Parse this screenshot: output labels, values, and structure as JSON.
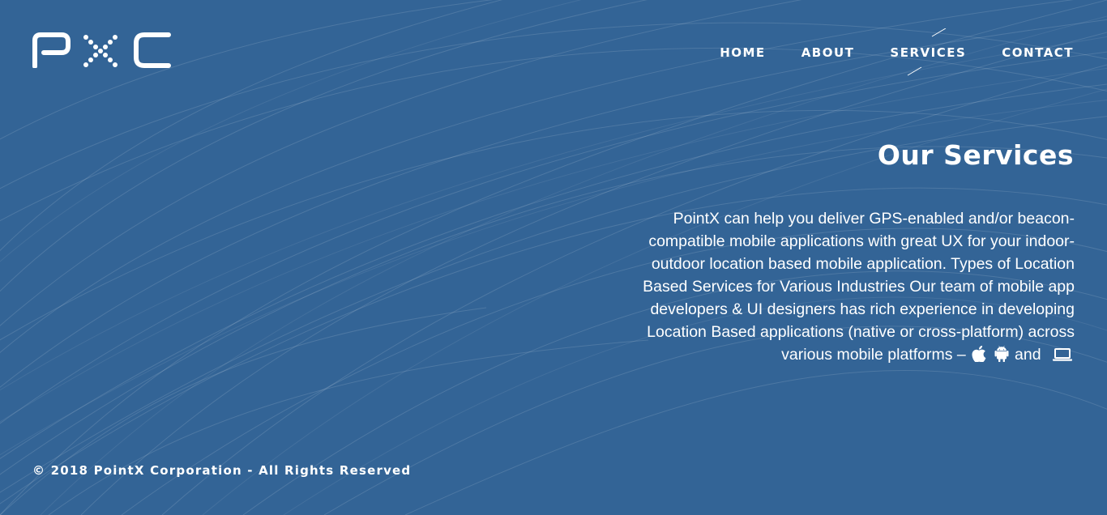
{
  "brand": {
    "logo_text": "PXC"
  },
  "nav": {
    "items": [
      {
        "label": "HOME"
      },
      {
        "label": "ABOUT"
      },
      {
        "label": "SERVICES"
      },
      {
        "label": "CONTACT"
      }
    ],
    "active": "SERVICES"
  },
  "main": {
    "title": "Our Services",
    "body": "PointX can help you deliver GPS-enabled and/or beacon-compatible mobile applications with great UX for your indoor-outdoor location based mobile application. Types of Location Based Services for Various Industries Our team of mobile app developers & UI designers has rich experience in developing Location Based applications (native or cross-platform) across various mobile platforms –",
    "platforms_joiner": "and",
    "platform_icons": [
      "apple-icon",
      "android-icon",
      "laptop-icon"
    ]
  },
  "footer": {
    "copyright": "© 2018 PointX Corporation - All Rights Reserved"
  },
  "colors": {
    "background": "#336496",
    "text": "#ffffff"
  }
}
